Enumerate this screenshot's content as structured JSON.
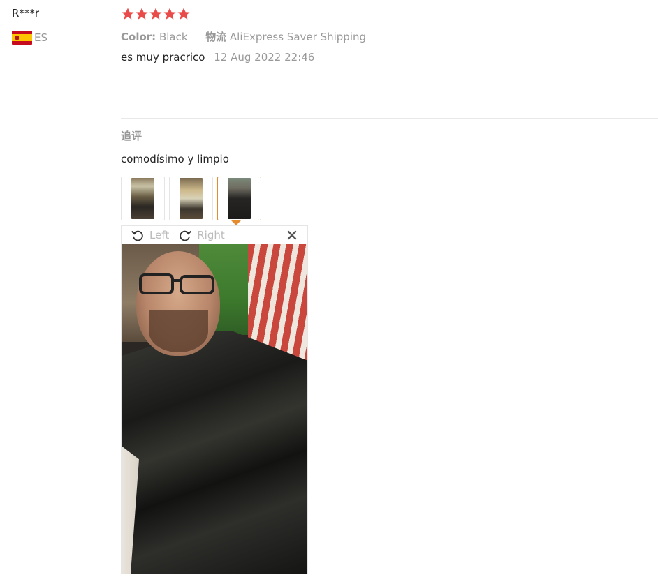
{
  "user": {
    "name": "R***r",
    "country_code": "ES",
    "flag": "spain-flag"
  },
  "rating": {
    "stars": 5,
    "max": 5,
    "color": "#e94a4a"
  },
  "meta": {
    "color_key": "Color:",
    "color_value": "Black",
    "shipping_key": "物流",
    "shipping_value": "AliExpress Saver Shipping"
  },
  "review": {
    "text": "es muy pracrico",
    "date": "12 Aug 2022 22:46"
  },
  "followup": {
    "label": "追评",
    "text": "comodísimo y limpio"
  },
  "thumbnails": [
    {
      "name": "photo-1",
      "active": false
    },
    {
      "name": "photo-2",
      "active": false
    },
    {
      "name": "photo-3",
      "active": true
    }
  ],
  "viewer": {
    "rotate_left": "Left",
    "rotate_right": "Right",
    "accent": "#e68a2e"
  }
}
